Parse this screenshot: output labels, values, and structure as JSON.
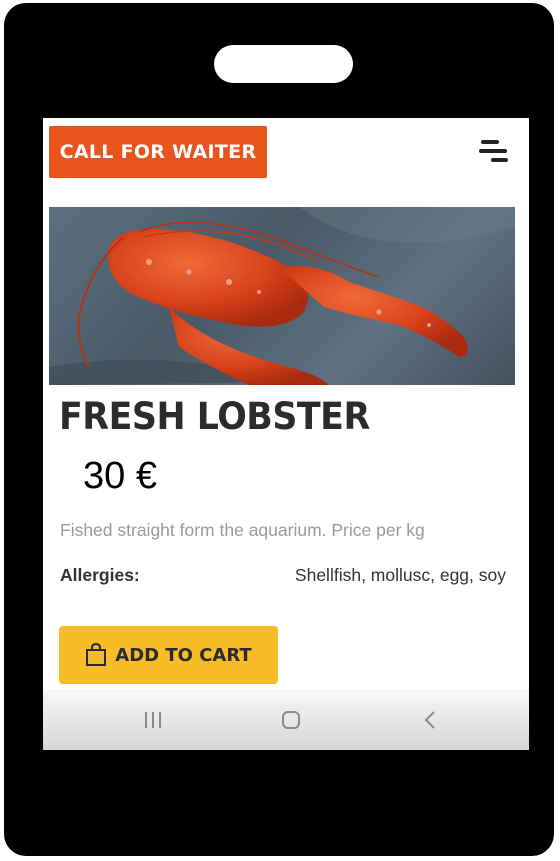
{
  "header": {
    "call_waiter_label": "CALL FOR WAITER",
    "menu_icon": "hamburger-menu-icon"
  },
  "product": {
    "image_alt": "Fresh lobster",
    "name": "FRESH LOBSTER",
    "price": "30 €",
    "description": "Fished straight form the aquarium. Price per kg",
    "allergies_label": "Allergies:",
    "allergies_value": "Shellfish, mollusc, egg, soy"
  },
  "actions": {
    "add_to_cart_label": "ADD TO CART",
    "add_to_cart_icon": "shopping-bag-icon"
  },
  "navbar": {
    "items": [
      "recent-apps-icon",
      "home-icon",
      "back-icon"
    ]
  },
  "colors": {
    "waiter_button": "#e8541e",
    "cart_button": "#f7bd27",
    "title_text": "#2c2c2c",
    "description_text": "#9a9a9a"
  }
}
